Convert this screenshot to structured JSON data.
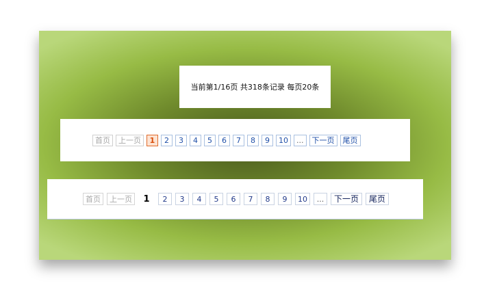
{
  "summary": {
    "text": "当前第1/16页 共318条记录 每页20条"
  },
  "pager1": {
    "first": "首页",
    "prev": "上一页",
    "current": "1",
    "pages": [
      "2",
      "3",
      "4",
      "5",
      "6",
      "7",
      "8",
      "9",
      "10"
    ],
    "ellipsis": "...",
    "next": "下一页",
    "last": "尾页"
  },
  "pager2": {
    "first": "首页",
    "prev": "上一页",
    "current": "1",
    "pages": [
      "2",
      "3",
      "4",
      "5",
      "6",
      "7",
      "8",
      "9",
      "10"
    ],
    "ellipsis": "...",
    "next": "下一页",
    "last": "尾页"
  },
  "colors": {
    "background_green": "#97bb45",
    "link_blue": "#1f4fa8",
    "current_orange": "#e06a2a"
  }
}
